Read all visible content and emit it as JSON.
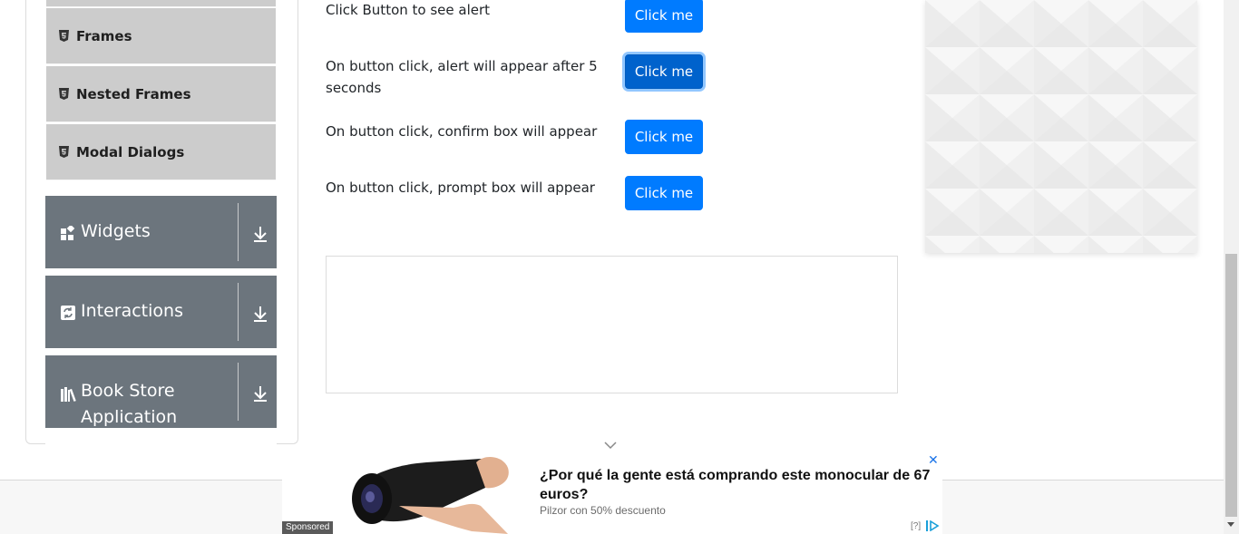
{
  "sidebar": {
    "sub_items": [
      {
        "label": "Frames",
        "icon": "html5-icon"
      },
      {
        "label": "Nested Frames",
        "icon": "html5-icon"
      },
      {
        "label": "Modal Dialogs",
        "icon": "html5-icon"
      }
    ],
    "groups": [
      {
        "label": "Widgets",
        "icon": "widgets-icon"
      },
      {
        "label": "Interactions",
        "icon": "interactions-icon"
      },
      {
        "label": "Book Store Application",
        "label_line1": "Book Store",
        "label_line2": "Application",
        "icon": "books-icon"
      }
    ]
  },
  "main": {
    "rows": [
      {
        "text": "Click Button to see alert",
        "button": "Click me"
      },
      {
        "text_line1": "On button click, alert will appear after 5",
        "text_line2": "seconds",
        "button": "Click me",
        "focused": true
      },
      {
        "text": "On button click, confirm box will appear",
        "button": "Click me"
      },
      {
        "text": "On button click, prompt box will appear",
        "button": "Click me"
      }
    ]
  },
  "ad": {
    "title": "¿Por qué la gente está comprando este monocular de 67 euros?",
    "subtitle": "Pilzor con 50% descuento",
    "sponsored": "Sponsored",
    "help": "[?]",
    "close": "✕"
  },
  "colors": {
    "primary": "#007bff",
    "sidebar_group": "#6c757d",
    "sidebar_sub": "#cccccc"
  }
}
